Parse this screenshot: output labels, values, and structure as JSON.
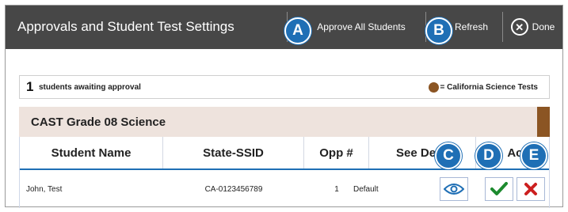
{
  "header": {
    "title": "Approvals and Student Test Settings",
    "approve_all_label": "Approve All Students",
    "refresh_label": "Refresh",
    "done_label": "Done",
    "done_icon_glyph": "✕"
  },
  "callouts": [
    "A",
    "B",
    "C",
    "D",
    "E"
  ],
  "summary": {
    "count": "1",
    "text": "students awaiting approval",
    "legend_label": "= California Science Tests",
    "legend_color": "#8b5523"
  },
  "test_group": {
    "title": "CAST Grade 08 Science",
    "color": "#8b5523"
  },
  "table": {
    "headers": {
      "name": "Student Name",
      "ssid": "State-SSID",
      "opp": "Opp #",
      "detail": "See Details",
      "action": "Action"
    },
    "rows": [
      {
        "name": "John, Test",
        "ssid": "CA-0123456789",
        "opp": "1",
        "detail": "Default"
      }
    ]
  },
  "icons": {
    "view": "eye-icon",
    "approve": "checkmark-icon",
    "deny": "x-icon"
  },
  "colors": {
    "header_bg": "#474747",
    "callout": "#1f6fb5",
    "approve_green": "#1d8a2e",
    "deny_red": "#cc1f1f"
  }
}
